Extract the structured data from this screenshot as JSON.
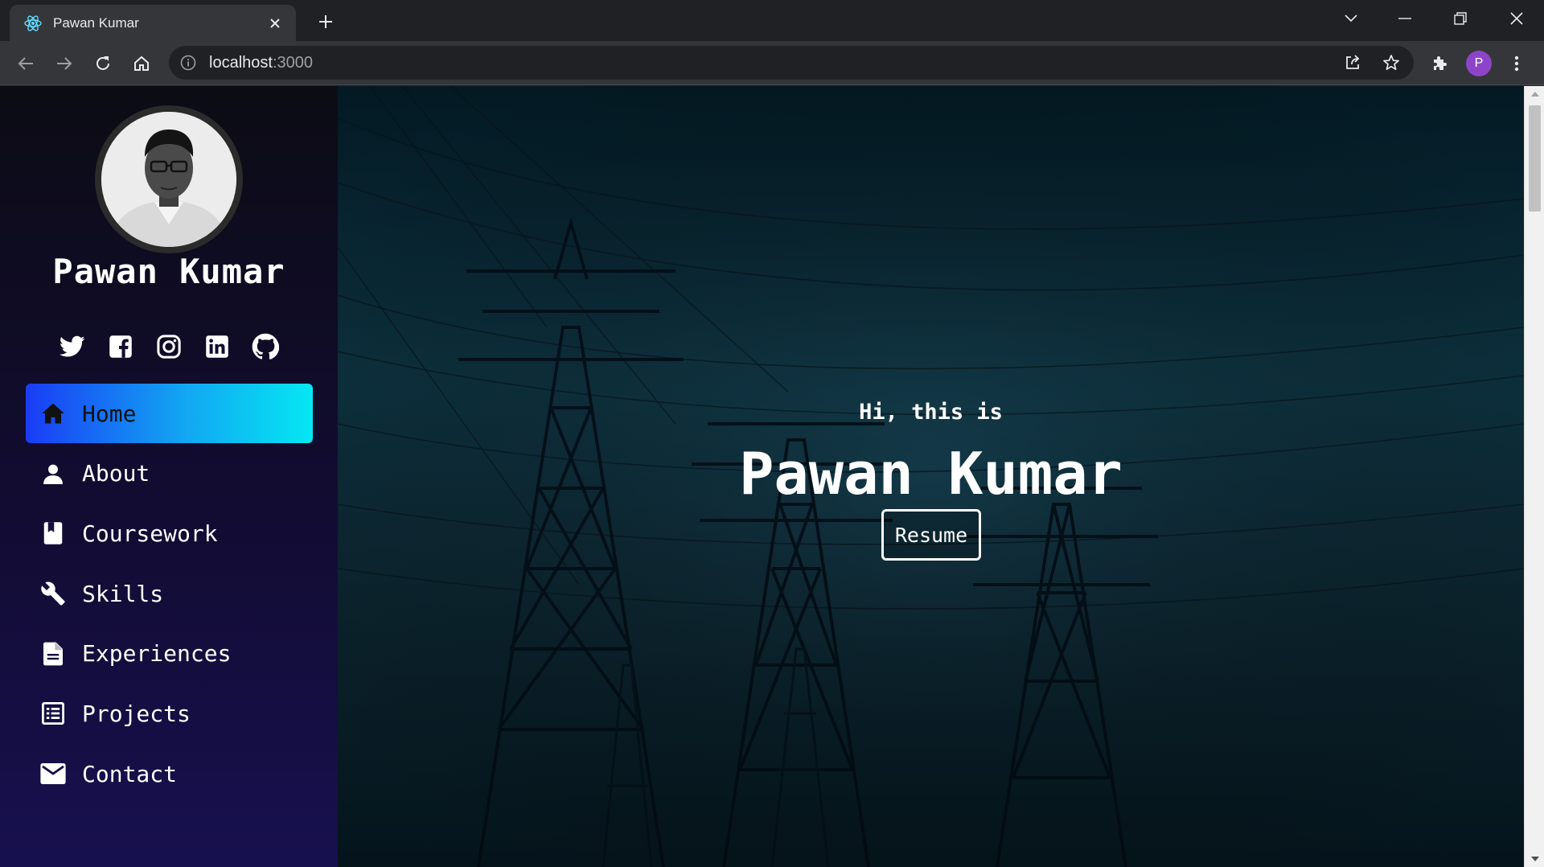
{
  "browser": {
    "tab_title": "Pawan Kumar",
    "url_host": "localhost",
    "url_port": ":3000",
    "profile_initial": "P"
  },
  "sidebar": {
    "name": "Pawan Kumar",
    "socials": [
      "twitter-icon",
      "facebook-icon",
      "instagram-icon",
      "linkedin-icon",
      "github-icon"
    ],
    "nav": [
      {
        "label": "Home",
        "icon": "home-icon",
        "active": true
      },
      {
        "label": "About",
        "icon": "person-icon",
        "active": false
      },
      {
        "label": "Coursework",
        "icon": "book-icon",
        "active": false
      },
      {
        "label": "Skills",
        "icon": "wrench-icon",
        "active": false
      },
      {
        "label": "Experiences",
        "icon": "document-icon",
        "active": false
      },
      {
        "label": "Projects",
        "icon": "list-icon",
        "active": false
      },
      {
        "label": "Contact",
        "icon": "mail-icon",
        "active": false
      }
    ]
  },
  "hero": {
    "greeting": "Hi, this is",
    "name": "Pawan Kumar",
    "resume_label": "Resume"
  },
  "colors": {
    "nav_active_start": "#1a3cf5",
    "nav_active_end": "#05e7f2",
    "sidebar_bottom": "#17104f",
    "hero_bg": "#0d3240"
  }
}
